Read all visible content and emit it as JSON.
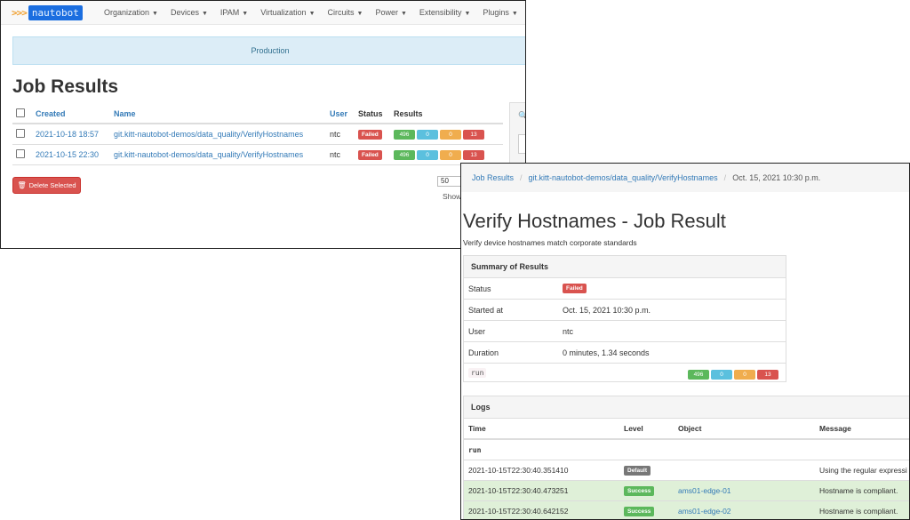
{
  "nav": {
    "logo_arrows": ">>>",
    "logo_text": "nautobot",
    "menu": [
      {
        "label": "Organization"
      },
      {
        "label": "Devices"
      },
      {
        "label": "IPAM"
      },
      {
        "label": "Virtualization"
      },
      {
        "label": "Circuits"
      },
      {
        "label": "Power"
      },
      {
        "label": "Extensibility"
      },
      {
        "label": "Plugins"
      }
    ]
  },
  "banner": "Production",
  "job_results": {
    "title": "Job Results",
    "columns": [
      "Created",
      "Name",
      "User",
      "Status",
      "Results"
    ],
    "rows": [
      {
        "created": "2021-10-18 18:57",
        "name": "git.kitt-nautobot-demos/data_quality/VerifyHostnames",
        "user": "ntc",
        "status": "Failed",
        "r1": "496",
        "r2": "0",
        "r3": "0",
        "r4": "13"
      },
      {
        "created": "2021-10-15 22:30",
        "name": "git.kitt-nautobot-demos/data_quality/VerifyHostnames",
        "user": "ntc",
        "status": "Failed",
        "r1": "496",
        "r2": "0",
        "r3": "0",
        "r4": "13"
      }
    ],
    "delete_label": "Delete Selected",
    "per_page": "50",
    "show_text": "Show"
  },
  "detail": {
    "breadcrumb": {
      "root": "Job Results",
      "job": "git.kitt-nautobot-demos/data_quality/VerifyHostnames",
      "current": "Oct. 15, 2021 10:30 p.m."
    },
    "title": "Verify Hostnames - Job Result",
    "subtitle": "Verify device hostnames match corporate standards",
    "summary": {
      "heading": "Summary of Results",
      "status_label": "Status",
      "status_value": "Failed",
      "started_label": "Started at",
      "started_value": "Oct. 15, 2021 10:30 p.m.",
      "user_label": "User",
      "user_value": "ntc",
      "duration_label": "Duration",
      "duration_value": "0 minutes, 1.34 seconds",
      "run_label": "run",
      "r1": "496",
      "r2": "0",
      "r3": "0",
      "r4": "13"
    },
    "logs": {
      "heading": "Logs",
      "columns": [
        "Time",
        "Level",
        "Object",
        "Message"
      ],
      "group": "run",
      "rows": [
        {
          "time": "2021-10-15T22:30:40.351410",
          "level": "Default",
          "object": "",
          "message": "Using the regular expressi"
        },
        {
          "time": "2021-10-15T22:30:40.473251",
          "level": "Success",
          "object": "ams01-edge-01",
          "message": "Hostname is compliant."
        },
        {
          "time": "2021-10-15T22:30:40.642152",
          "level": "Success",
          "object": "ams01-edge-02",
          "message": "Hostname is compliant."
        }
      ]
    }
  },
  "colors": {
    "primary": "#337ab7",
    "danger": "#d9534f",
    "success": "#5cb85c",
    "info": "#5bc0de",
    "warning": "#f0ad4e"
  }
}
